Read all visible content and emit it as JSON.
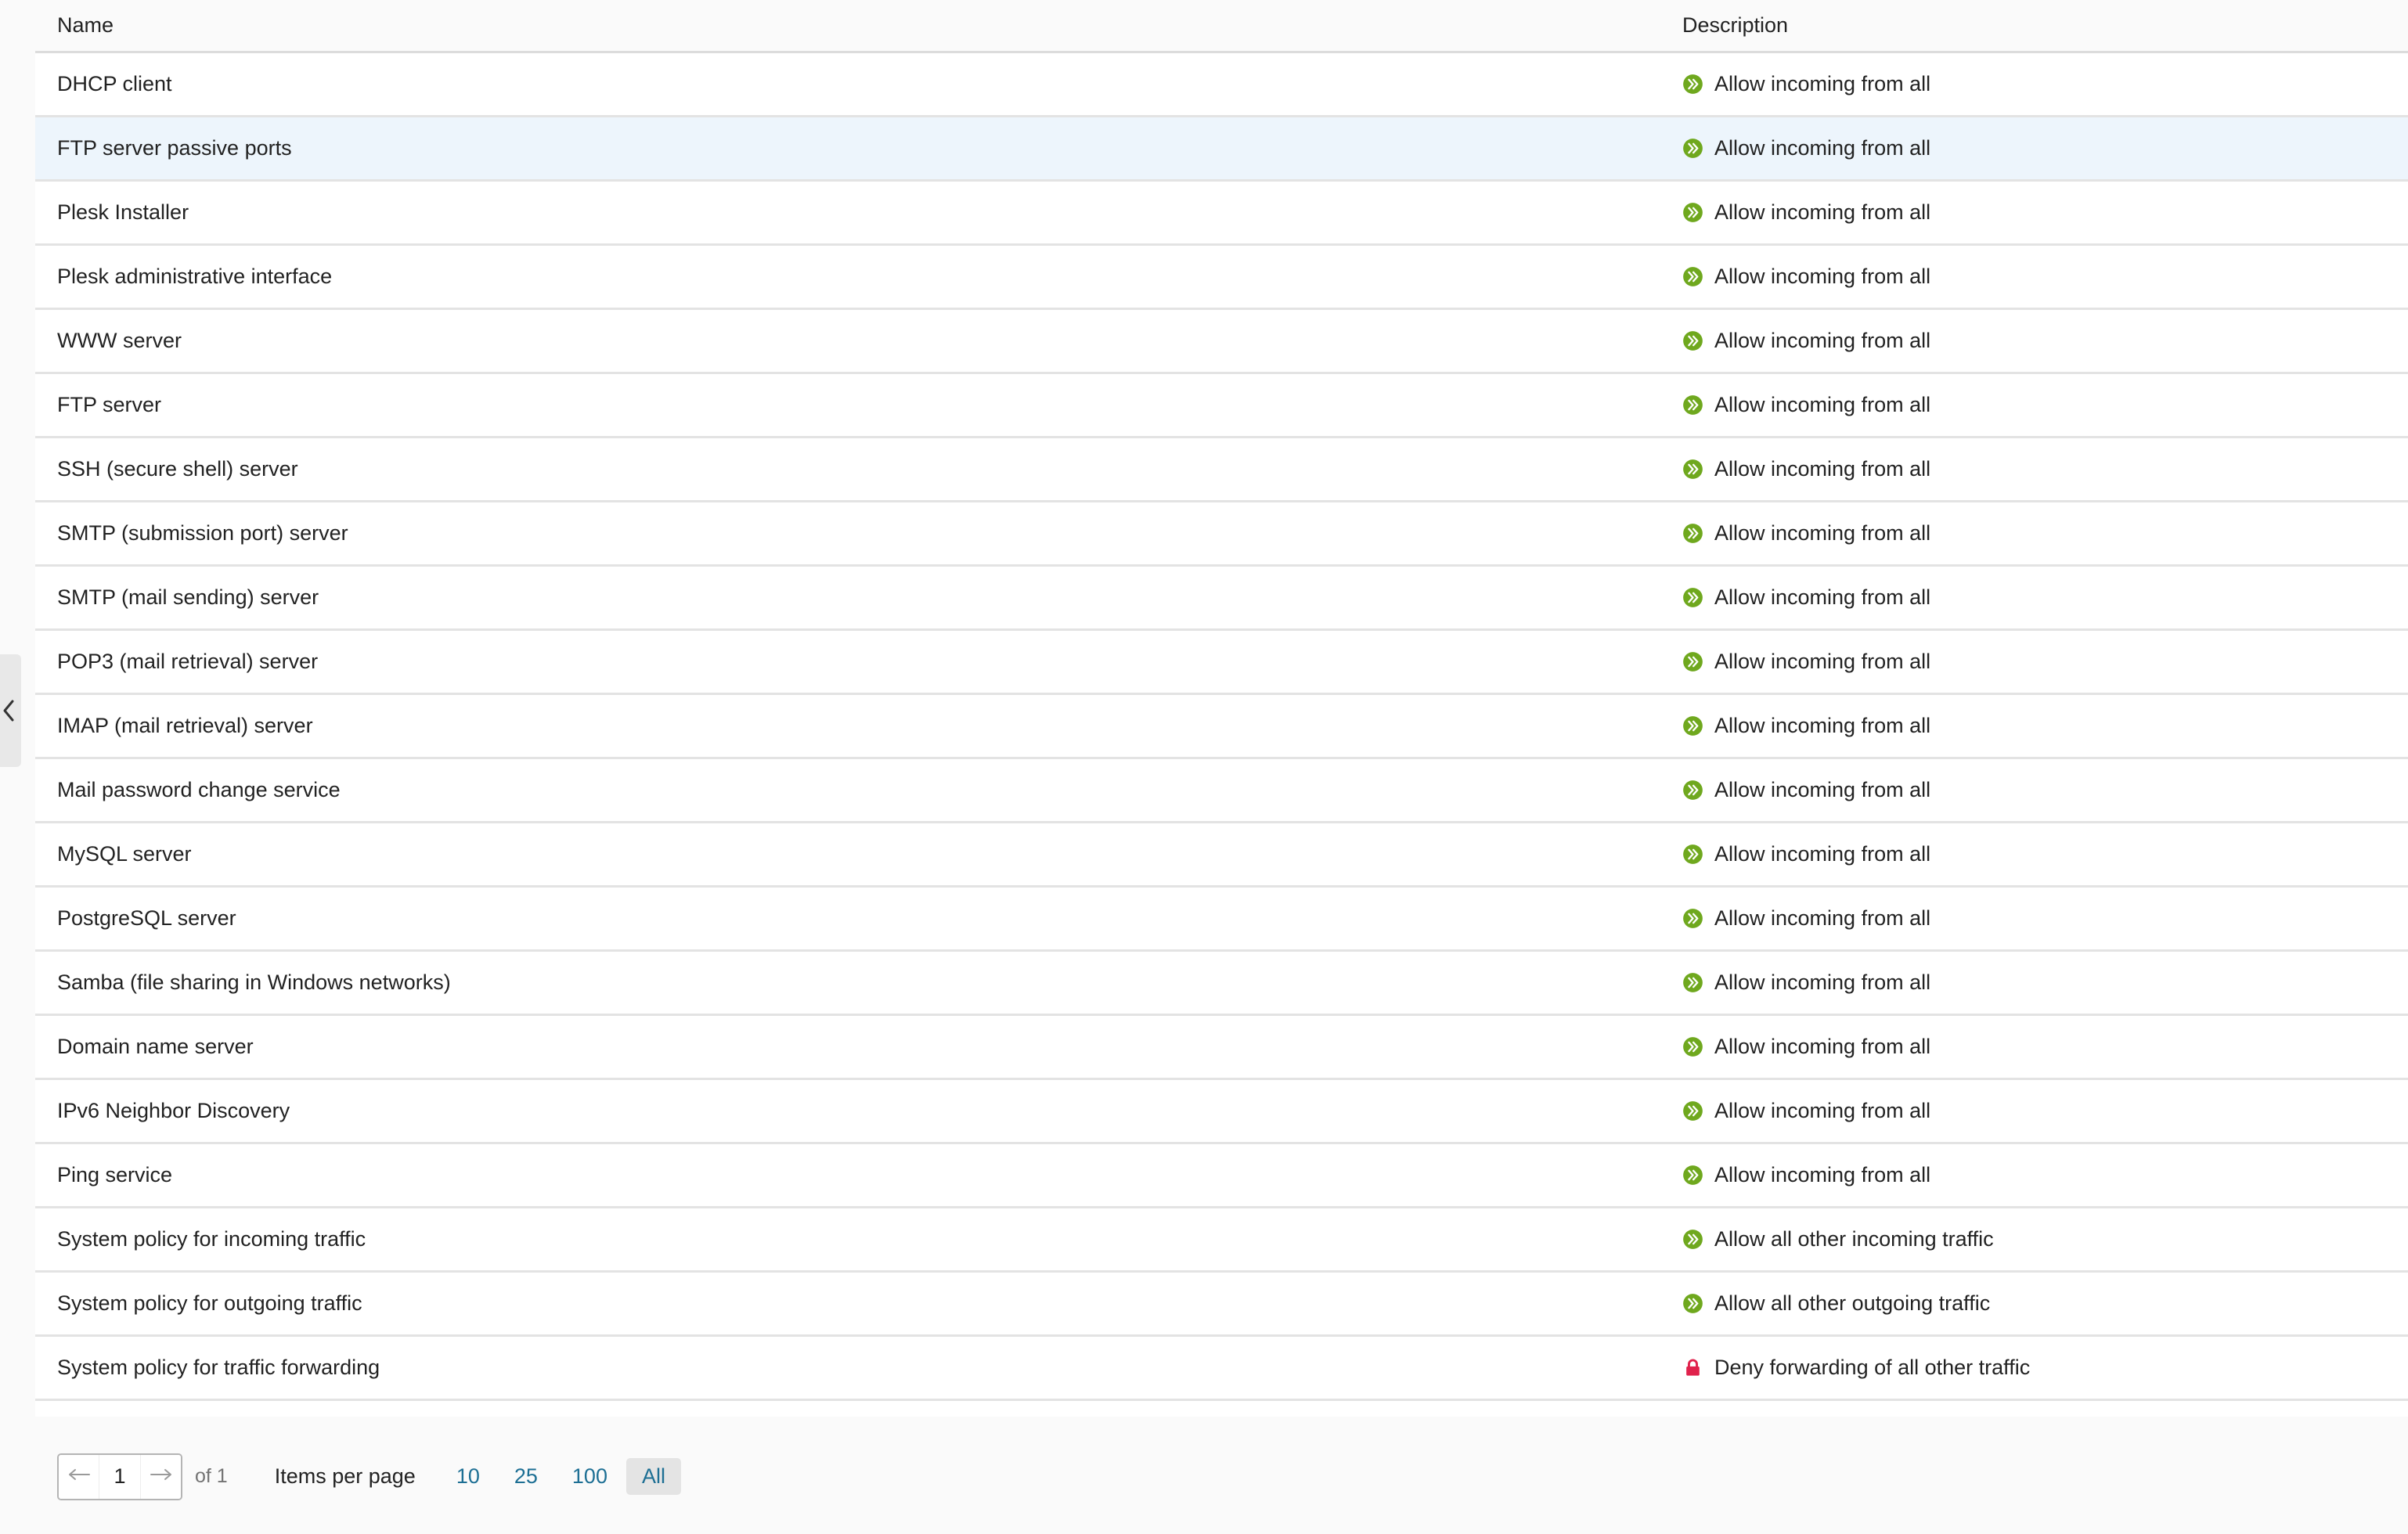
{
  "table": {
    "columns": [
      {
        "key": "name",
        "label": "Name"
      },
      {
        "key": "description",
        "label": "Description"
      }
    ],
    "rows": [
      {
        "name": "DHCP client",
        "description": "Allow incoming from all",
        "icon": "allow-arrows-icon",
        "hovered": false
      },
      {
        "name": "FTP server passive ports",
        "description": "Allow incoming from all",
        "icon": "allow-arrows-icon",
        "hovered": true
      },
      {
        "name": "Plesk Installer",
        "description": "Allow incoming from all",
        "icon": "allow-arrows-icon",
        "hovered": false
      },
      {
        "name": "Plesk administrative interface",
        "description": "Allow incoming from all",
        "icon": "allow-arrows-icon",
        "hovered": false
      },
      {
        "name": "WWW server",
        "description": "Allow incoming from all",
        "icon": "allow-arrows-icon",
        "hovered": false
      },
      {
        "name": "FTP server",
        "description": "Allow incoming from all",
        "icon": "allow-arrows-icon",
        "hovered": false
      },
      {
        "name": "SSH (secure shell) server",
        "description": "Allow incoming from all",
        "icon": "allow-arrows-icon",
        "hovered": false
      },
      {
        "name": "SMTP (submission port) server",
        "description": "Allow incoming from all",
        "icon": "allow-arrows-icon",
        "hovered": false
      },
      {
        "name": "SMTP (mail sending) server",
        "description": "Allow incoming from all",
        "icon": "allow-arrows-icon",
        "hovered": false
      },
      {
        "name": "POP3 (mail retrieval) server",
        "description": "Allow incoming from all",
        "icon": "allow-arrows-icon",
        "hovered": false
      },
      {
        "name": "IMAP (mail retrieval) server",
        "description": "Allow incoming from all",
        "icon": "allow-arrows-icon",
        "hovered": false
      },
      {
        "name": "Mail password change service",
        "description": "Allow incoming from all",
        "icon": "allow-arrows-icon",
        "hovered": false
      },
      {
        "name": "MySQL server",
        "description": "Allow incoming from all",
        "icon": "allow-arrows-icon",
        "hovered": false
      },
      {
        "name": "PostgreSQL server",
        "description": "Allow incoming from all",
        "icon": "allow-arrows-icon",
        "hovered": false
      },
      {
        "name": "Samba (file sharing in Windows networks)",
        "description": "Allow incoming from all",
        "icon": "allow-arrows-icon",
        "hovered": false
      },
      {
        "name": "Domain name server",
        "description": "Allow incoming from all",
        "icon": "allow-arrows-icon",
        "hovered": false
      },
      {
        "name": "IPv6 Neighbor Discovery",
        "description": "Allow incoming from all",
        "icon": "allow-arrows-icon",
        "hovered": false
      },
      {
        "name": "Ping service",
        "description": "Allow incoming from all",
        "icon": "allow-arrows-icon",
        "hovered": false
      },
      {
        "name": "System policy for incoming traffic",
        "description": "Allow all other incoming traffic",
        "icon": "allow-arrows-icon",
        "hovered": false
      },
      {
        "name": "System policy for outgoing traffic",
        "description": "Allow all other outgoing traffic",
        "icon": "allow-arrows-icon",
        "hovered": false
      },
      {
        "name": "System policy for traffic forwarding",
        "description": "Deny forwarding of all other traffic",
        "icon": "deny-lock-icon",
        "hovered": false
      }
    ]
  },
  "pagination": {
    "prev_icon": "arrow-left-icon",
    "next_icon": "arrow-right-icon",
    "current_page": "1",
    "of_label": "of 1",
    "items_per_page_label": "Items per page",
    "options": [
      {
        "label": "10",
        "active": false
      },
      {
        "label": "25",
        "active": false
      },
      {
        "label": "100",
        "active": false
      },
      {
        "label": "All",
        "active": true
      }
    ]
  },
  "sidebar_toggle": {
    "icon": "chevron-left-icon"
  },
  "colors": {
    "allow_green": "#6fa81e",
    "deny_red": "#e0224c",
    "link_blue": "#1d6f94",
    "row_hover": "#edf5fc",
    "header_bg": "#fafafa",
    "row_border": "#e3e3e3"
  }
}
